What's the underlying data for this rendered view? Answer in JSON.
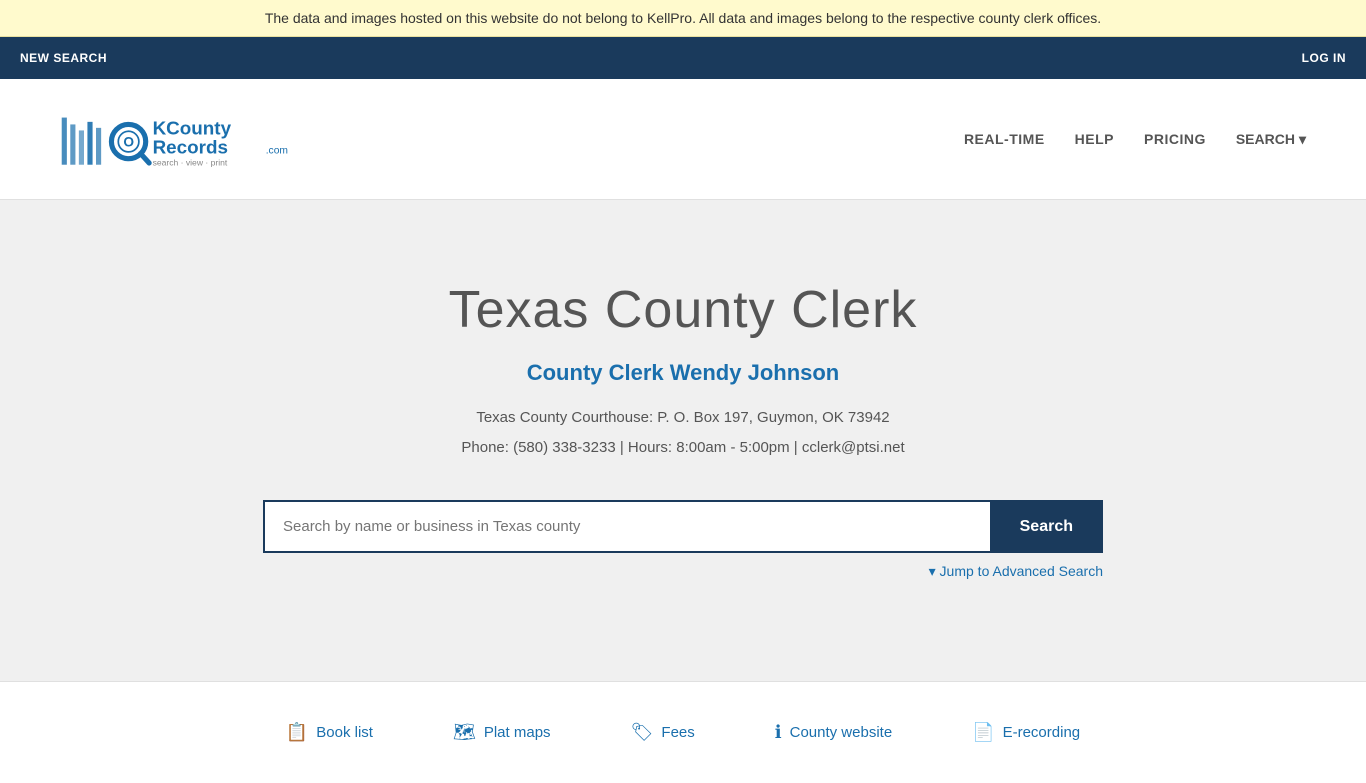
{
  "banner": {
    "text": "The data and images hosted on this website do not belong to KellPro. All data and images belong to the respective county clerk offices."
  },
  "top_nav": {
    "new_search": "NEW SEARCH",
    "log_in": "LOG IN"
  },
  "header": {
    "logo_alt": "OKCountyRecords.com - search · view · print",
    "nav": {
      "real_time": "REAL-TIME",
      "help": "HELP",
      "pricing": "PRICING",
      "search": "SEARCH"
    }
  },
  "hero": {
    "title": "Texas County Clerk",
    "clerk_name": "County Clerk Wendy Johnson",
    "address_line1": "Texas County Courthouse: P. O. Box 197, Guymon, OK 73942",
    "address_line2": "Phone: (580) 338-3233 | Hours: 8:00am - 5:00pm | cclerk@ptsi.net",
    "search_placeholder": "Search by name or business in Texas county",
    "search_button": "Search",
    "advanced_link": "▾ Jump to Advanced Search"
  },
  "footer": {
    "links": [
      {
        "icon": "📋",
        "label": "Book list"
      },
      {
        "icon": "🗺",
        "label": "Plat maps"
      },
      {
        "icon": "🏷",
        "label": "Fees"
      },
      {
        "icon": "ℹ",
        "label": "County website"
      },
      {
        "icon": "📄",
        "label": "E-recording"
      }
    ]
  }
}
